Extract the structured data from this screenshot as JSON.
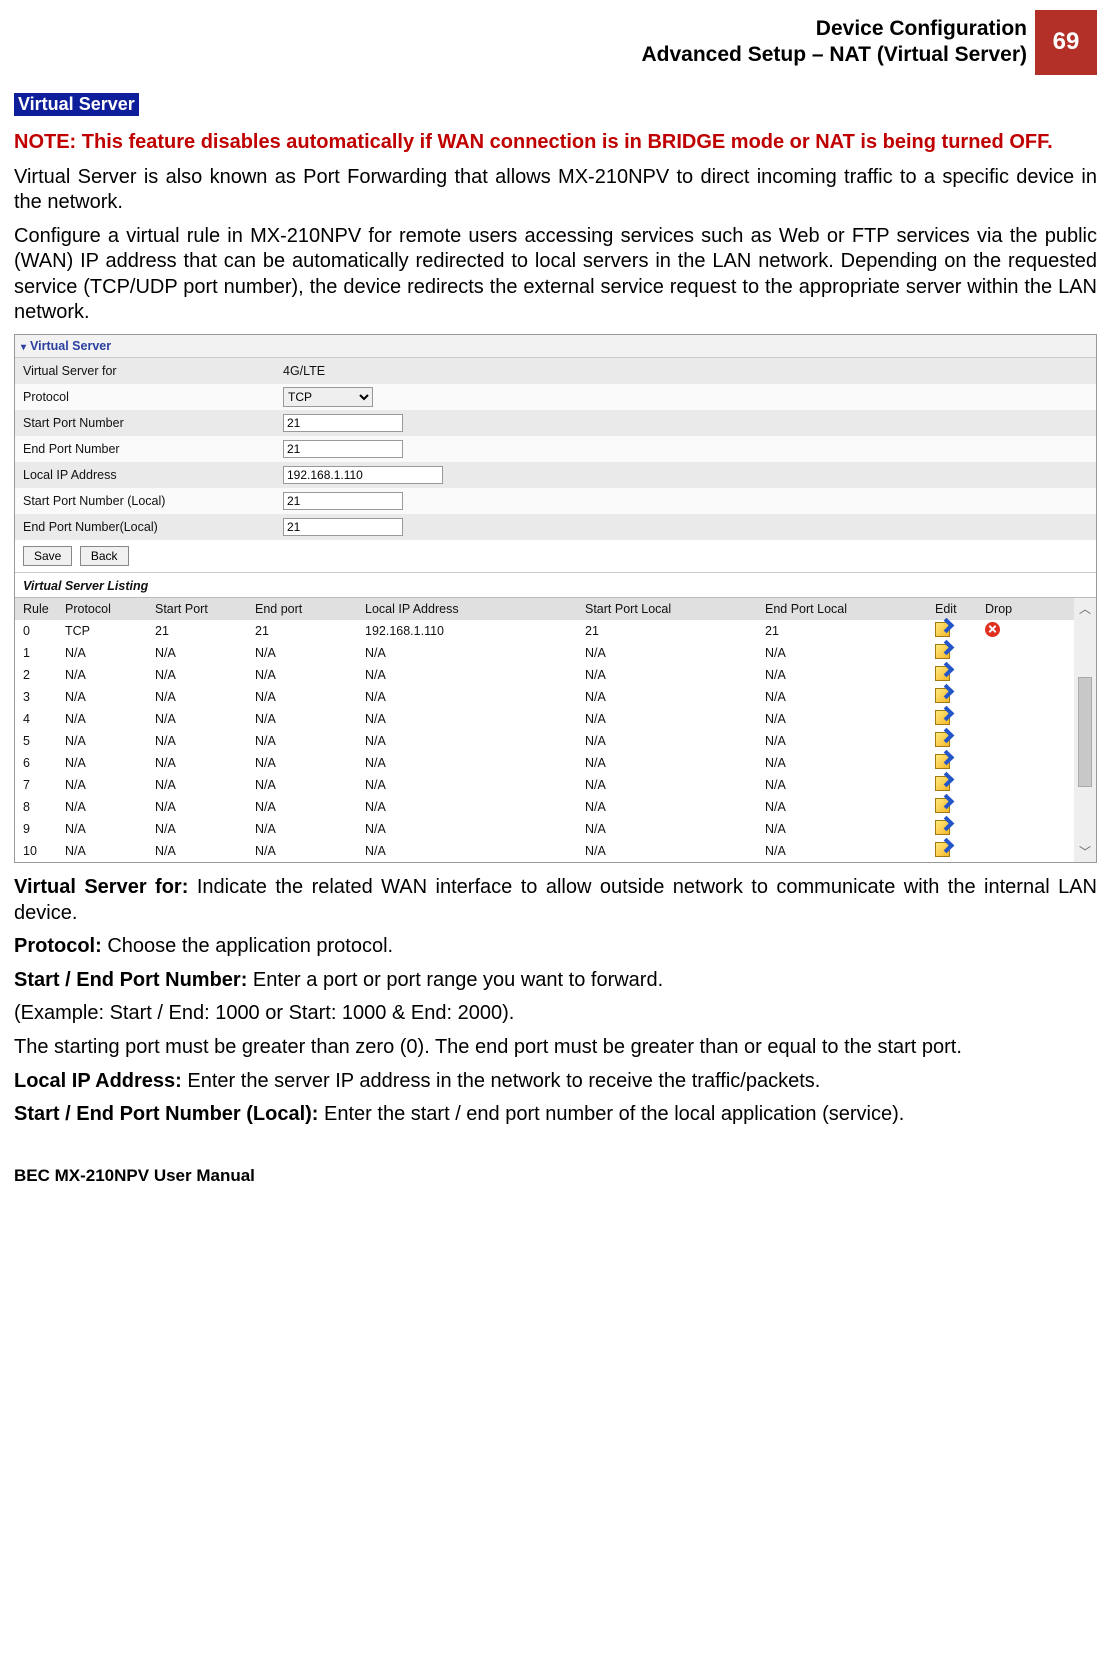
{
  "header": {
    "line1": "Device Configuration",
    "line2": "Advanced Setup – NAT (Virtual Server)",
    "page_number": "69"
  },
  "section_badge": "Virtual Server",
  "note": "NOTE: This feature disables automatically if WAN connection is in BRIDGE mode or NAT is being turned OFF.",
  "para1": "Virtual Server is also known as Port Forwarding that allows MX-210NPV to direct incoming traffic to a specific device in the network.",
  "para2": "Configure a virtual rule in MX-210NPV for remote users accessing services such as Web or FTP services via the public (WAN) IP address that can be automatically redirected to local servers in the LAN network. Depending on the requested service (TCP/UDP port number), the device redirects the external service request to the appropriate server within the LAN network.",
  "ui": {
    "panel_title": "Virtual Server",
    "form": {
      "rows": [
        {
          "label": "Virtual Server for",
          "type": "text",
          "value": "4G/LTE"
        },
        {
          "label": "Protocol",
          "type": "select",
          "value": "TCP"
        },
        {
          "label": "Start Port Number",
          "type": "input",
          "value": "21"
        },
        {
          "label": "End Port Number",
          "type": "input",
          "value": "21"
        },
        {
          "label": "Local IP Address",
          "type": "input_ip",
          "value": "192.168.1.110"
        },
        {
          "label": "Start Port Number (Local)",
          "type": "input",
          "value": "21"
        },
        {
          "label": "End Port Number(Local)",
          "type": "input",
          "value": "21"
        }
      ],
      "save_label": "Save",
      "back_label": "Back"
    },
    "listing": {
      "title": "Virtual Server Listing",
      "headers": {
        "rule": "Rule",
        "protocol": "Protocol",
        "start": "Start Port",
        "end": "End port",
        "ip": "Local IP Address",
        "startl": "Start Port Local",
        "endl": "End Port Local",
        "edit": "Edit",
        "drop": "Drop"
      },
      "rows": [
        {
          "rule": "0",
          "protocol": "TCP",
          "start": "21",
          "end": "21",
          "ip": "192.168.1.110",
          "startl": "21",
          "endl": "21",
          "drop": true
        },
        {
          "rule": "1",
          "protocol": "N/A",
          "start": "N/A",
          "end": "N/A",
          "ip": "N/A",
          "startl": "N/A",
          "endl": "N/A",
          "drop": false
        },
        {
          "rule": "2",
          "protocol": "N/A",
          "start": "N/A",
          "end": "N/A",
          "ip": "N/A",
          "startl": "N/A",
          "endl": "N/A",
          "drop": false
        },
        {
          "rule": "3",
          "protocol": "N/A",
          "start": "N/A",
          "end": "N/A",
          "ip": "N/A",
          "startl": "N/A",
          "endl": "N/A",
          "drop": false
        },
        {
          "rule": "4",
          "protocol": "N/A",
          "start": "N/A",
          "end": "N/A",
          "ip": "N/A",
          "startl": "N/A",
          "endl": "N/A",
          "drop": false
        },
        {
          "rule": "5",
          "protocol": "N/A",
          "start": "N/A",
          "end": "N/A",
          "ip": "N/A",
          "startl": "N/A",
          "endl": "N/A",
          "drop": false
        },
        {
          "rule": "6",
          "protocol": "N/A",
          "start": "N/A",
          "end": "N/A",
          "ip": "N/A",
          "startl": "N/A",
          "endl": "N/A",
          "drop": false
        },
        {
          "rule": "7",
          "protocol": "N/A",
          "start": "N/A",
          "end": "N/A",
          "ip": "N/A",
          "startl": "N/A",
          "endl": "N/A",
          "drop": false
        },
        {
          "rule": "8",
          "protocol": "N/A",
          "start": "N/A",
          "end": "N/A",
          "ip": "N/A",
          "startl": "N/A",
          "endl": "N/A",
          "drop": false
        },
        {
          "rule": "9",
          "protocol": "N/A",
          "start": "N/A",
          "end": "N/A",
          "ip": "N/A",
          "startl": "N/A",
          "endl": "N/A",
          "drop": false
        },
        {
          "rule": "10",
          "protocol": "N/A",
          "start": "N/A",
          "end": "N/A",
          "ip": "N/A",
          "startl": "N/A",
          "endl": "N/A",
          "drop": false
        }
      ]
    }
  },
  "defs": [
    {
      "label": "Virtual Server for:",
      "text": "  Indicate the related WAN interface to allow outside network to communicate with the internal LAN device."
    },
    {
      "label": "Protocol:",
      "text": " Choose the application protocol."
    },
    {
      "label": "Start / End Port Number:",
      "text": " Enter a port or port range you want to forward."
    },
    {
      "label": "",
      "text": "(Example: Start / End: 1000 or Start: 1000 & End: 2000)."
    },
    {
      "label": "",
      "text": "The starting port must be greater than zero (0).  The end port must be greater than or equal to the start port."
    },
    {
      "label": "Local IP Address:",
      "text": " Enter the server IP address in the network to receive the traffic/packets."
    },
    {
      "label": "Start / End Port Number (Local):",
      "text": " Enter the start / end port number of the local application (service)."
    }
  ],
  "footer": "BEC MX-210NPV User Manual"
}
